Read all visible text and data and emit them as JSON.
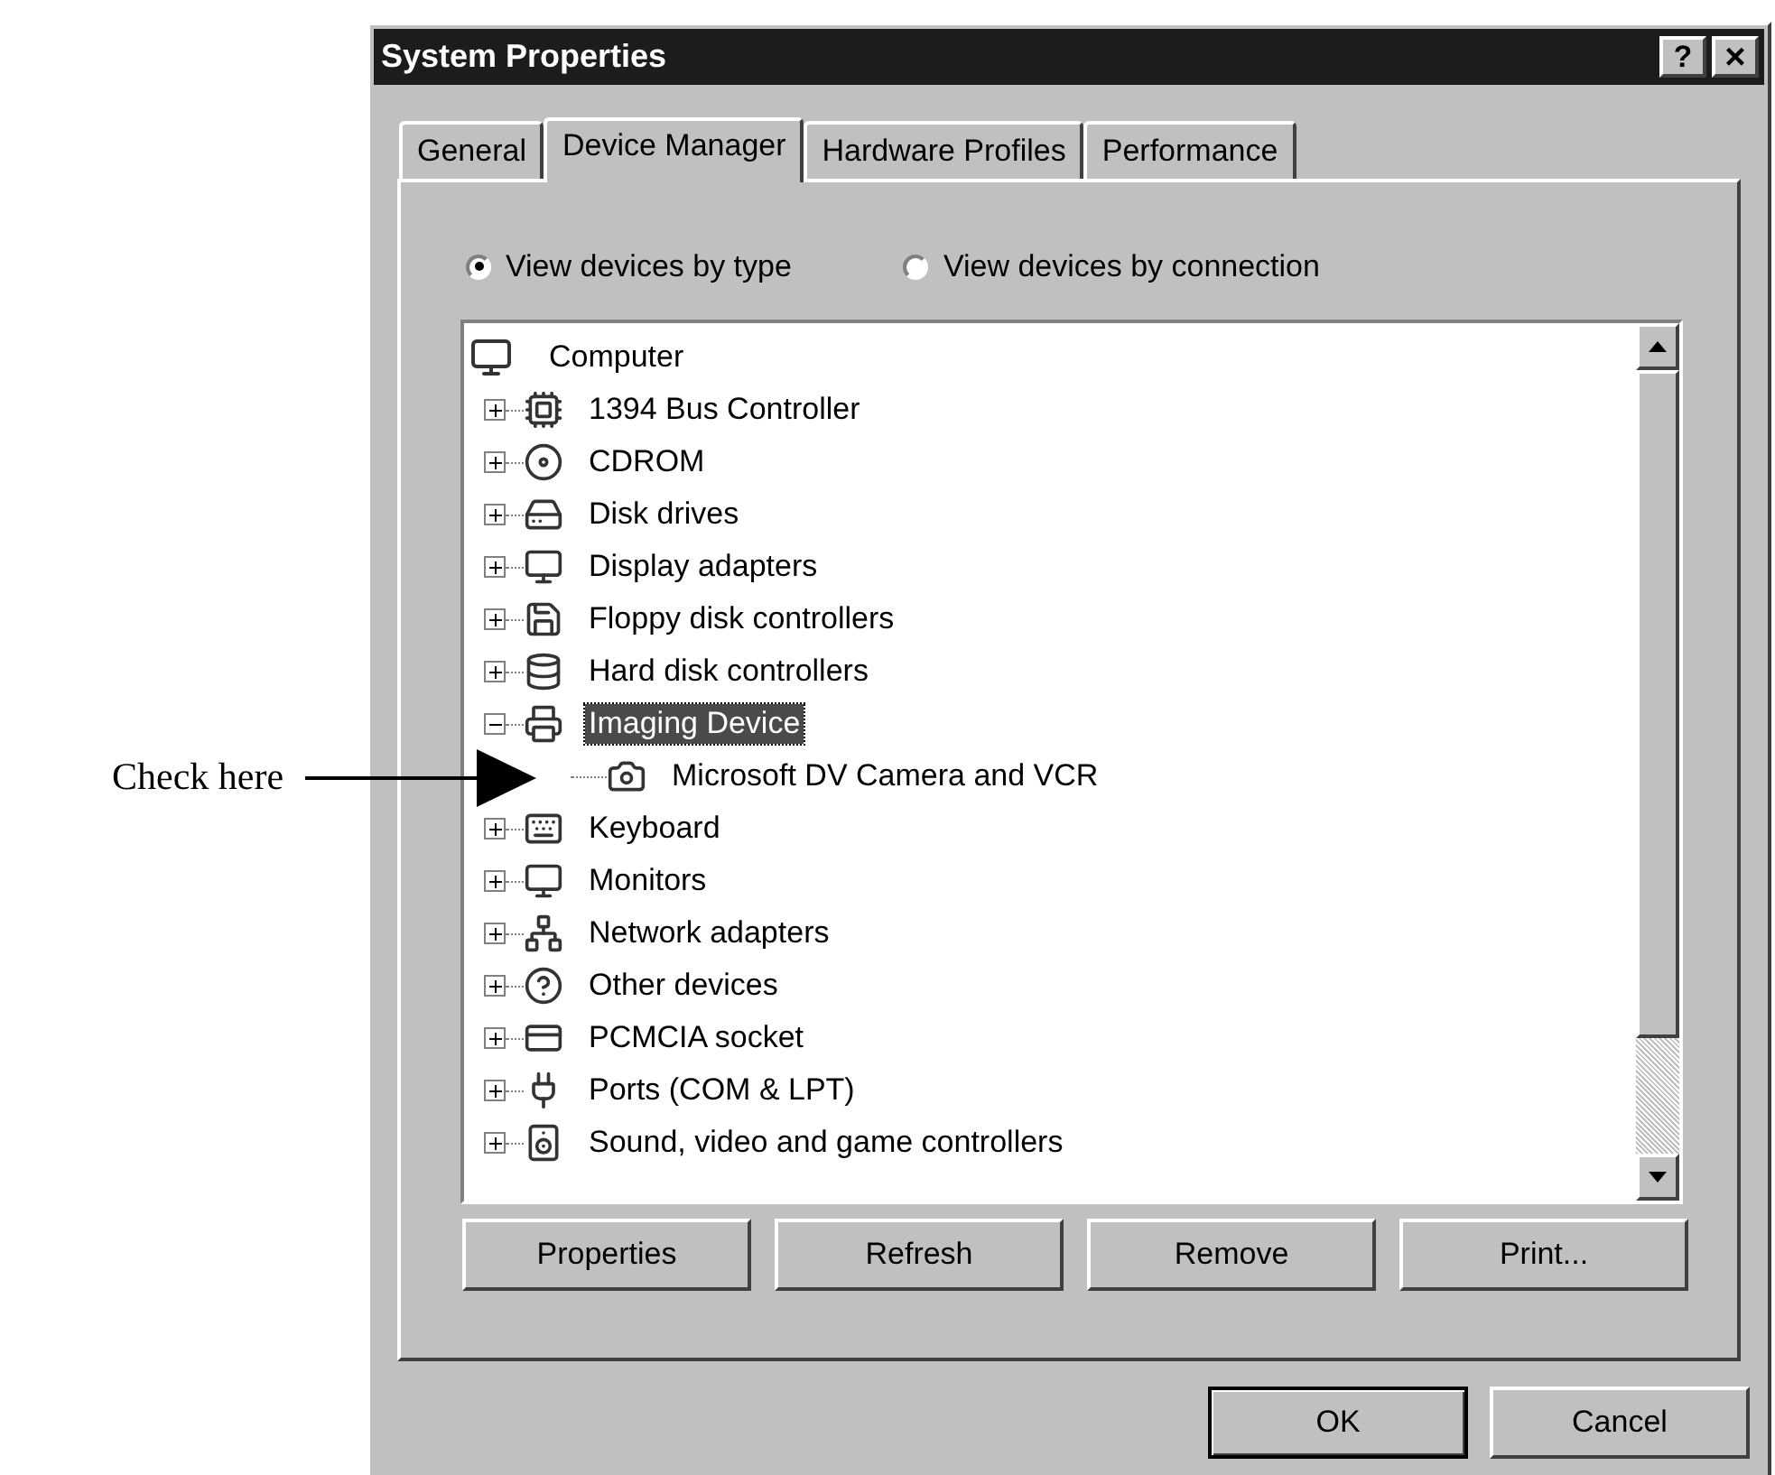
{
  "annotation": {
    "label": "Check here"
  },
  "window": {
    "title": "System Properties",
    "help_button": "?",
    "close_button": "×"
  },
  "tabs": [
    {
      "label": "General",
      "selected": false
    },
    {
      "label": "Device Manager",
      "selected": true
    },
    {
      "label": "Hardware Profiles",
      "selected": false
    },
    {
      "label": "Performance",
      "selected": false
    }
  ],
  "view_options": [
    {
      "label": "View devices by type",
      "selected": true
    },
    {
      "label": "View devices by connection",
      "selected": false
    }
  ],
  "device_tree": {
    "root": {
      "label": "Computer",
      "selected": false,
      "children": [
        {
          "label": "1394 Bus Controller",
          "expanded": false,
          "selected": false
        },
        {
          "label": "CDROM",
          "expanded": false,
          "selected": false
        },
        {
          "label": "Disk drives",
          "expanded": false,
          "selected": false
        },
        {
          "label": "Display adapters",
          "expanded": false,
          "selected": false
        },
        {
          "label": "Floppy disk controllers",
          "expanded": false,
          "selected": false
        },
        {
          "label": "Hard disk controllers",
          "expanded": false,
          "selected": false
        },
        {
          "label": "Imaging Device",
          "expanded": true,
          "selected": true,
          "children": [
            {
              "label": "Microsoft DV Camera and VCR",
              "selected": false
            }
          ]
        },
        {
          "label": "Keyboard",
          "expanded": false,
          "selected": false
        },
        {
          "label": "Monitors",
          "expanded": false,
          "selected": false
        },
        {
          "label": "Network adapters",
          "expanded": false,
          "selected": false
        },
        {
          "label": "Other devices",
          "expanded": false,
          "selected": false
        },
        {
          "label": "PCMCIA socket",
          "expanded": false,
          "selected": false
        },
        {
          "label": "Ports (COM & LPT)",
          "expanded": false,
          "selected": false
        },
        {
          "label": "Sound, video and game controllers",
          "expanded": false,
          "selected": false
        }
      ]
    }
  },
  "panel_buttons": [
    "Properties",
    "Refresh",
    "Remove",
    "Print..."
  ],
  "dialog_buttons": [
    {
      "label": "OK",
      "default": true
    },
    {
      "label": "Cancel",
      "default": false
    }
  ]
}
